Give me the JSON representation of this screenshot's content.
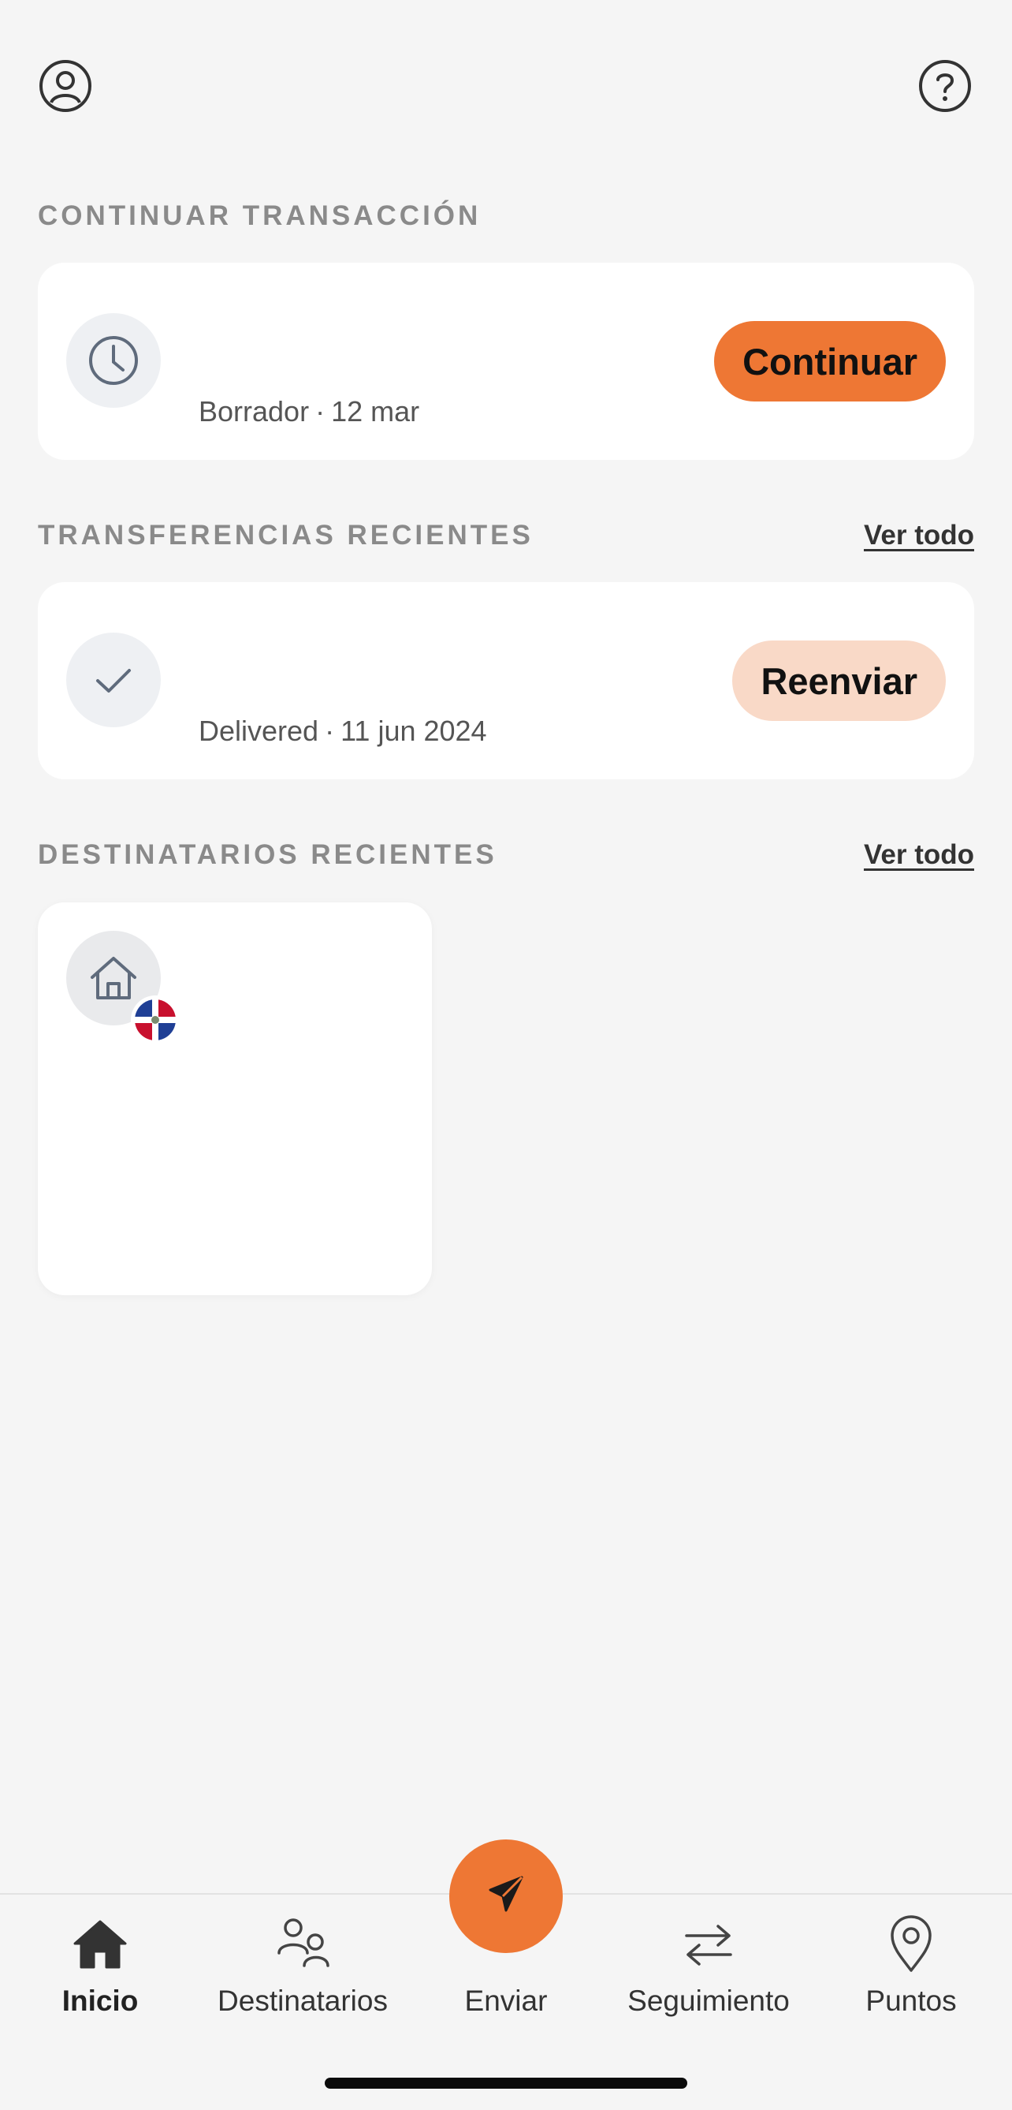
{
  "continue_section": {
    "title": "CONTINUAR TRANSACCIÓN",
    "status": "Borrador",
    "date": "12 mar",
    "button_label": "Continuar",
    "icon": "clock-icon"
  },
  "recent_transfers": {
    "title": "TRANSFERENCIAS RECIENTES",
    "see_all": "Ver todo",
    "status": "Delivered",
    "date": "11 jun 2024",
    "button_label": "Reenviar",
    "icon": "check-icon"
  },
  "recent_recipients": {
    "title": "DESTINATARIOS RECIENTES",
    "see_all": "Ver todo",
    "recipient_icon": "house-icon",
    "flag": "dominican-republic-flag-icon"
  },
  "bottom_nav": {
    "items": [
      {
        "label": "Inicio",
        "icon": "home-icon",
        "active": true
      },
      {
        "label": "Destinatarios",
        "icon": "people-icon",
        "active": false
      },
      {
        "label": "Enviar",
        "icon": "send-icon",
        "active": false
      },
      {
        "label": "Seguimiento",
        "icon": "transfer-arrows-icon",
        "active": false
      },
      {
        "label": "Puntos",
        "icon": "location-pin-icon",
        "active": false
      }
    ]
  },
  "colors": {
    "accent": "#ee7734",
    "accent_soft": "#f9d9c7",
    "background": "#f5f5f5",
    "card": "#ffffff"
  }
}
